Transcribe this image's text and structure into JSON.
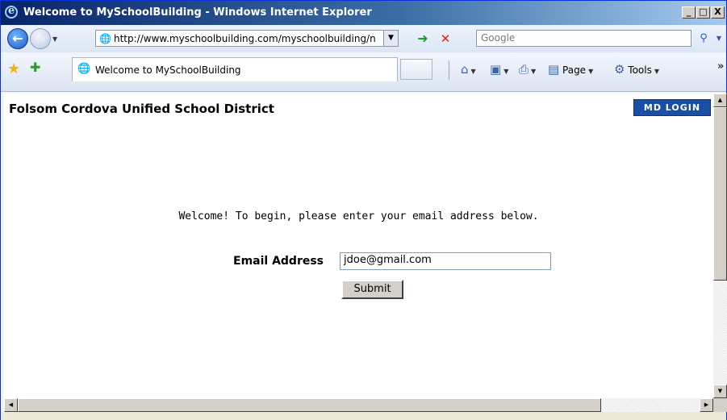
{
  "window": {
    "title": "Welcome to MySchoolBuilding - Windows Internet Explorer",
    "minimize_label": "_",
    "maximize_label": "□",
    "close_label": "X"
  },
  "address_bar": {
    "back_icon": "back-arrow-icon",
    "forward_icon": "forward-arrow-icon",
    "url": "http://www.myschoolbuilding.com/myschoolbuilding/n",
    "go_icon": "go-arrow-icon",
    "stop_icon": "stop-x-icon",
    "search_placeholder": "Google",
    "search_icon": "magnifier-icon"
  },
  "tab_bar": {
    "tab_title": "Welcome to MySchoolBuilding",
    "tools": {
      "home_icon": "home-icon",
      "feeds_icon": "feeds-icon",
      "print_icon": "print-icon",
      "page_label": "Page",
      "tools_label": "Tools"
    },
    "overflow_label": "»"
  },
  "page": {
    "district_name": "Folsom Cordova Unified School District",
    "md_login_label": "MD LOGIN",
    "welcome_text": "Welcome! To begin, please enter your email address below.",
    "email_label": "Email Address",
    "email_value": "jdoe@gmail.com",
    "submit_label": "Submit"
  },
  "colors": {
    "title_bar": "#0a246a",
    "md_login_bg": "#1a4fa5",
    "go_green": "#1c9a2c",
    "stop_red": "#dd2222"
  }
}
